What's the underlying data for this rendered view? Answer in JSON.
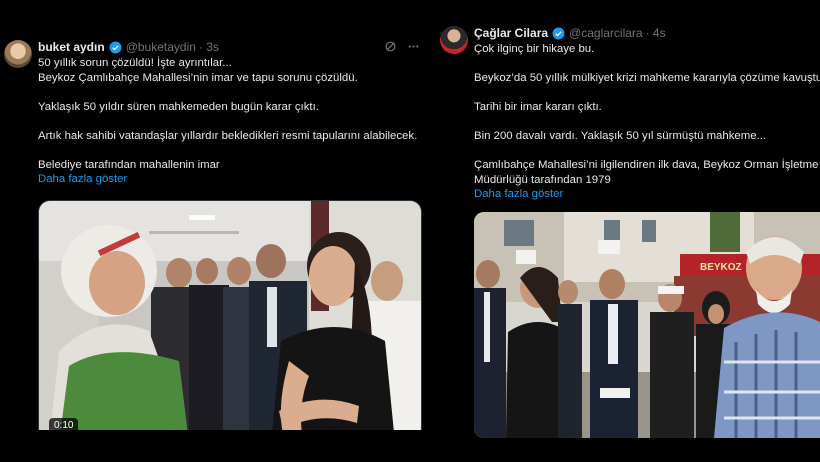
{
  "tweet1": {
    "name": "buket aydın",
    "handle": "@buketaydin",
    "time": "· 3s",
    "lines": [
      "50 yıllık sorun çözüldü! İşte ayrıntılar...",
      "Beykoz Çamlıbahçe Mahallesi’nin imar ve tapu sorunu çözüldü.",
      "",
      "Yaklaşık 50 yıldır süren mahkemeden bugün karar çıktı.",
      "",
      "Artık hak sahibi vatandaşlar yıllardır bekledikleri resmi tapularını alabilecek.",
      "",
      "Belediye tarafından mahallenin imar"
    ],
    "show_more": "Daha fazla göster",
    "video_duration": "0:10"
  },
  "tweet2": {
    "name": "Çağlar Cilara",
    "handle": "@caglarcilara",
    "time": "· 4s",
    "lines": [
      "Çok ilginç bir hikaye bu.",
      "",
      "Beykoz’da 50 yıllık mülkiyet krizi mahkeme kararıyla çözüme kavuştu.",
      "",
      "Tarihi bir imar kararı çıktı.",
      "",
      "Bin 200 davalı vardı. Yaklaşık 50 yıl sürmüştü mahkeme...",
      "",
      "Çamlıbahçe Mahallesi’ni ilgilendiren ilk dava, Beykoz Orman İşletme",
      "Müdürlüğü tarafından 1979"
    ],
    "show_more": "Daha fazla göster",
    "sign_text": "BEYKOZ"
  },
  "colors": {
    "link": "#1d9bf0",
    "verified": "#1d9bf0",
    "muted": "#71767b"
  }
}
